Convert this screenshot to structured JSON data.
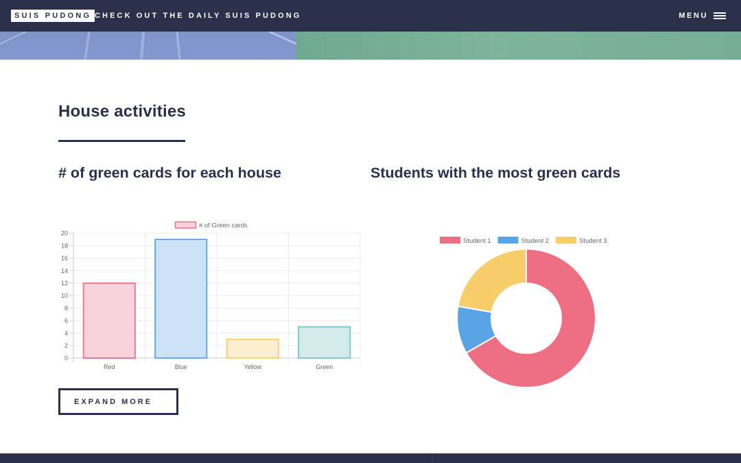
{
  "header": {
    "brand": "SUIS PUDONG",
    "tagline": "CHECK OUT THE DAILY SUIS PUDONG",
    "menu_label": "MENU",
    "menu_icon": "hamburger-icon"
  },
  "main": {
    "section_title": "House activities",
    "bar_heading": "# of green cards for each house",
    "donut_heading": "Students with the most green cards",
    "expand_label": "EXPAND MORE"
  },
  "chart_data": [
    {
      "type": "bar",
      "categories": [
        "Red",
        "Blue",
        "Yellow",
        "Green"
      ],
      "series": [
        {
          "name": "# of Green cards",
          "values": [
            12,
            19,
            3,
            5
          ]
        }
      ],
      "ylim": [
        0,
        20
      ],
      "yticks": [
        0,
        2,
        4,
        6,
        8,
        10,
        12,
        14,
        16,
        18,
        20
      ],
      "grid": true,
      "legend": "top-center",
      "fill_colors": [
        "#f9d3dc",
        "#cce2f7",
        "#fcefcf",
        "#d3ebeb"
      ],
      "border_colors": [
        "#ee6e84",
        "#5aa4e6",
        "#f8ce6b",
        "#76c5c4"
      ]
    },
    {
      "type": "pie",
      "style": "doughnut",
      "labels": [
        "Student 1",
        "Student 2",
        "Student 3"
      ],
      "values": [
        300,
        50,
        100
      ],
      "colors": [
        "#ee6e84",
        "#5aa4e6",
        "#f8ce6b"
      ],
      "legend": "top-center"
    }
  ]
}
